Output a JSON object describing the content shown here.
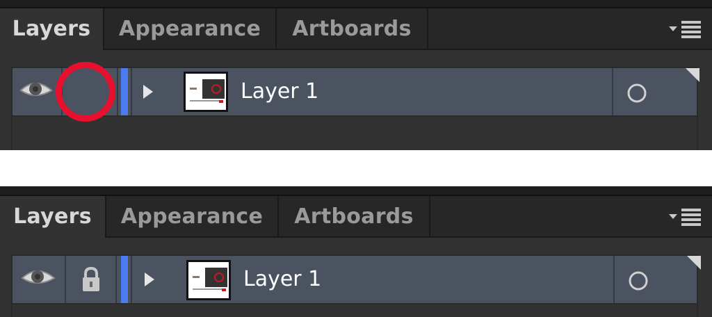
{
  "panels": [
    {
      "tabs": [
        {
          "label": "Layers",
          "active": true
        },
        {
          "label": "Appearance",
          "active": false
        },
        {
          "label": "Artboards",
          "active": false
        }
      ],
      "layer": {
        "name": "Layer 1",
        "visible": true,
        "locked": false,
        "color": "#4a7bf0"
      },
      "annotation": {
        "type": "red-circle",
        "color": "#e8102e",
        "target": "lock-toggle"
      }
    },
    {
      "tabs": [
        {
          "label": "Layers",
          "active": true
        },
        {
          "label": "Appearance",
          "active": false
        },
        {
          "label": "Artboards",
          "active": false
        }
      ],
      "layer": {
        "name": "Layer 1",
        "visible": true,
        "locked": true,
        "color": "#4a7bf0"
      }
    }
  ],
  "icons": {
    "visibility": "eye-icon",
    "lock": "lock-icon",
    "expand": "disclosure-triangle-icon",
    "target": "target-circle-icon",
    "menu": "panel-menu-icon"
  },
  "colors": {
    "panel_bg": "#323232",
    "tabbar_bg": "#272727",
    "row_bg": "#4b5260",
    "layer_color": "#4a7bf0",
    "annotation": "#e8102e"
  }
}
